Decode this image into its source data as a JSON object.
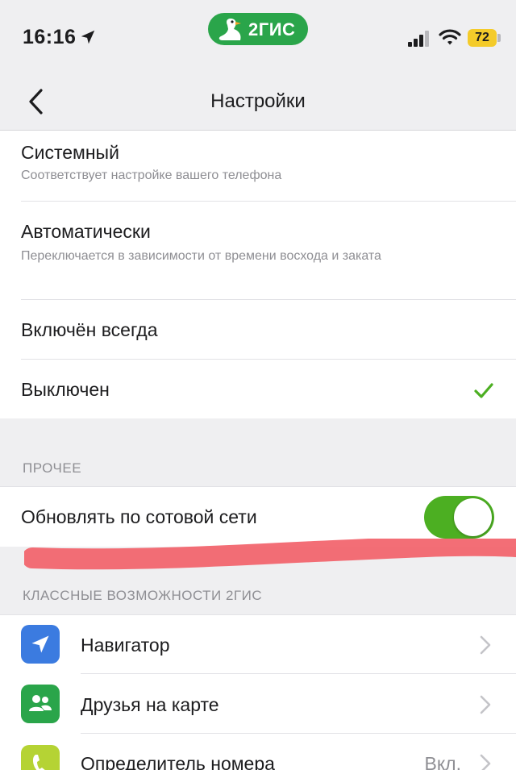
{
  "status_bar": {
    "time": "16:16",
    "brand": "2ГИС",
    "battery": "72"
  },
  "nav": {
    "title": "Настройки"
  },
  "theme_options": [
    {
      "title": "Системный",
      "subtitle": "Соответствует настройке вашего телефона"
    },
    {
      "title": "Автоматически",
      "subtitle": "Переключается в зависимости от времени восхода и заката"
    },
    {
      "title": "Включён всегда"
    },
    {
      "title": "Выключен",
      "selected": true
    }
  ],
  "other": {
    "header": "ПРОЧЕЕ",
    "cellular_update_label": "Обновлять по сотовой сети",
    "cellular_update_on": true
  },
  "features": {
    "header": "КЛАССНЫЕ ВОЗМОЖНОСТИ 2ГИС",
    "items": [
      {
        "label": "Навигатор",
        "icon": "navigation-arrow-icon",
        "color": "#3b7be0"
      },
      {
        "label": "Друзья на карте",
        "icon": "friends-icon",
        "color": "#2aa54a"
      },
      {
        "label": "Определитель номера",
        "icon": "phone-icon",
        "color": "#b5d334",
        "value": "Вкл."
      }
    ]
  },
  "colors": {
    "accent_green": "#4caf22",
    "brand_green": "#2aa54a",
    "battery_yellow": "#f4cb2a"
  }
}
